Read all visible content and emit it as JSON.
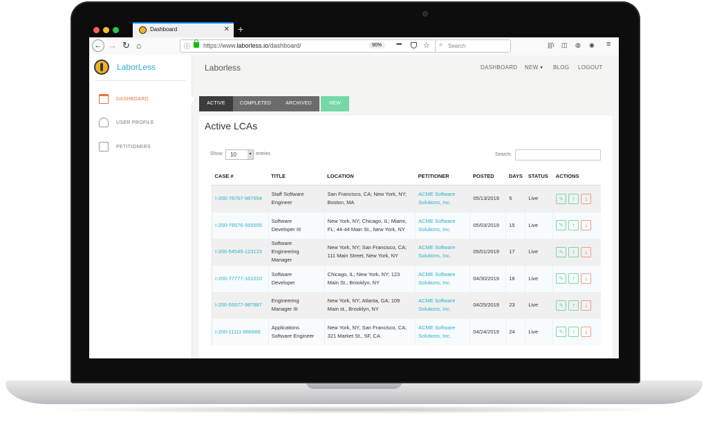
{
  "browser": {
    "tab_title": "Dashboard",
    "tab_close": "✕",
    "new_tab": "+",
    "url_prefix": "https://www.",
    "url_domain": "laborless.io",
    "url_path": "/dashboard/",
    "zoom": "90%",
    "search_placeholder": "Search",
    "traffic_lights": [
      "#ff5f57",
      "#febc2e",
      "#28c840"
    ]
  },
  "sidebar": {
    "brand": "LaborLess",
    "items": [
      {
        "label": "DASHBOARD",
        "icon": "bank-icon"
      },
      {
        "label": "USER PROFILE",
        "icon": "user-icon"
      },
      {
        "label": "PETITIONERS",
        "icon": "id-card-icon"
      }
    ]
  },
  "header": {
    "site_title": "Laborless",
    "nav": [
      "DASHBOARD",
      "NEW ▾",
      "BLOG",
      "LOGOUT"
    ]
  },
  "tabs": [
    "ACTIVE",
    "COMPLETED",
    "ARCHIVED",
    "NEW"
  ],
  "main": {
    "heading": "Active LCAs",
    "show_label": "Show",
    "show_value": "10",
    "entries_label": "entries",
    "search_label": "Search:",
    "columns": [
      "CASE #",
      "TITLE",
      "LOCATION",
      "PETITIONER",
      "POSTED",
      "DAYS",
      "STATUS",
      "ACTIONS"
    ],
    "rows": [
      {
        "case": "I-200-76767-987654",
        "title": [
          "Staff Software",
          "Engineer"
        ],
        "location": [
          "San Francisco, CA; New York, NY;",
          "Boston, MA"
        ],
        "petitioner": [
          "ACME Software",
          "Solutions, Inc."
        ],
        "posted": "05/13/2019",
        "days": "5",
        "status": "Live"
      },
      {
        "case": "I-200-76576-555555",
        "title": [
          "Software",
          "Developer III"
        ],
        "location": [
          "New York, NY; Chicago, IL; Miami,",
          "FL; 44-44 Main St., New York, NY"
        ],
        "petitioner": [
          "ACME Software",
          "Solutions, Inc."
        ],
        "posted": "05/03/2019",
        "days": "15",
        "status": "Live"
      },
      {
        "case": "I-200-54545-123123",
        "title": [
          "Software",
          "Engineering",
          "Manager"
        ],
        "location": [
          "New York, NY; San Francisco, CA;",
          "111 Main Street, New York, NY"
        ],
        "petitioner": [
          "ACME Software",
          "Solutions, Inc."
        ],
        "posted": "05/01/2019",
        "days": "17",
        "status": "Live"
      },
      {
        "case": "I-200-77777-101010",
        "title": [
          "Software",
          "Developer"
        ],
        "location": [
          "Chicago, IL; New York, NY; 123",
          "Main St., Brooklyn, NY"
        ],
        "petitioner": [
          "ACME Software",
          "Solutions, Inc."
        ],
        "posted": "04/30/2019",
        "days": "18",
        "status": "Live"
      },
      {
        "case": "I-200-55577-987987",
        "title": [
          "Engineering",
          "Manager III"
        ],
        "location": [
          "New York, NY; Atlanta, GA; 109",
          "Main st., Brooklyn, NY"
        ],
        "petitioner": [
          "ACME Software",
          "Solutions, Inc."
        ],
        "posted": "04/25/2019",
        "days": "23",
        "status": "Live"
      },
      {
        "case": "I-200-11111-666666",
        "title": [
          "Applications",
          "Software Engineer"
        ],
        "location": [
          "New York, NY; San Francisco, CA;",
          "321 Market St., SF, CA"
        ],
        "petitioner": [
          "ACME Software",
          "Solutions, Inc."
        ],
        "posted": "04/24/2019",
        "days": "24",
        "status": "Live"
      }
    ],
    "actions": [
      {
        "name": "edit-icon",
        "glyph": "✎"
      },
      {
        "name": "arrow-up-icon",
        "glyph": "↑"
      },
      {
        "name": "arrow-down-icon",
        "glyph": "↓"
      }
    ]
  },
  "colors": {
    "accent": "#2ab0c5",
    "active_nav": "#e8743b",
    "new_tab": "#74d9a5"
  }
}
